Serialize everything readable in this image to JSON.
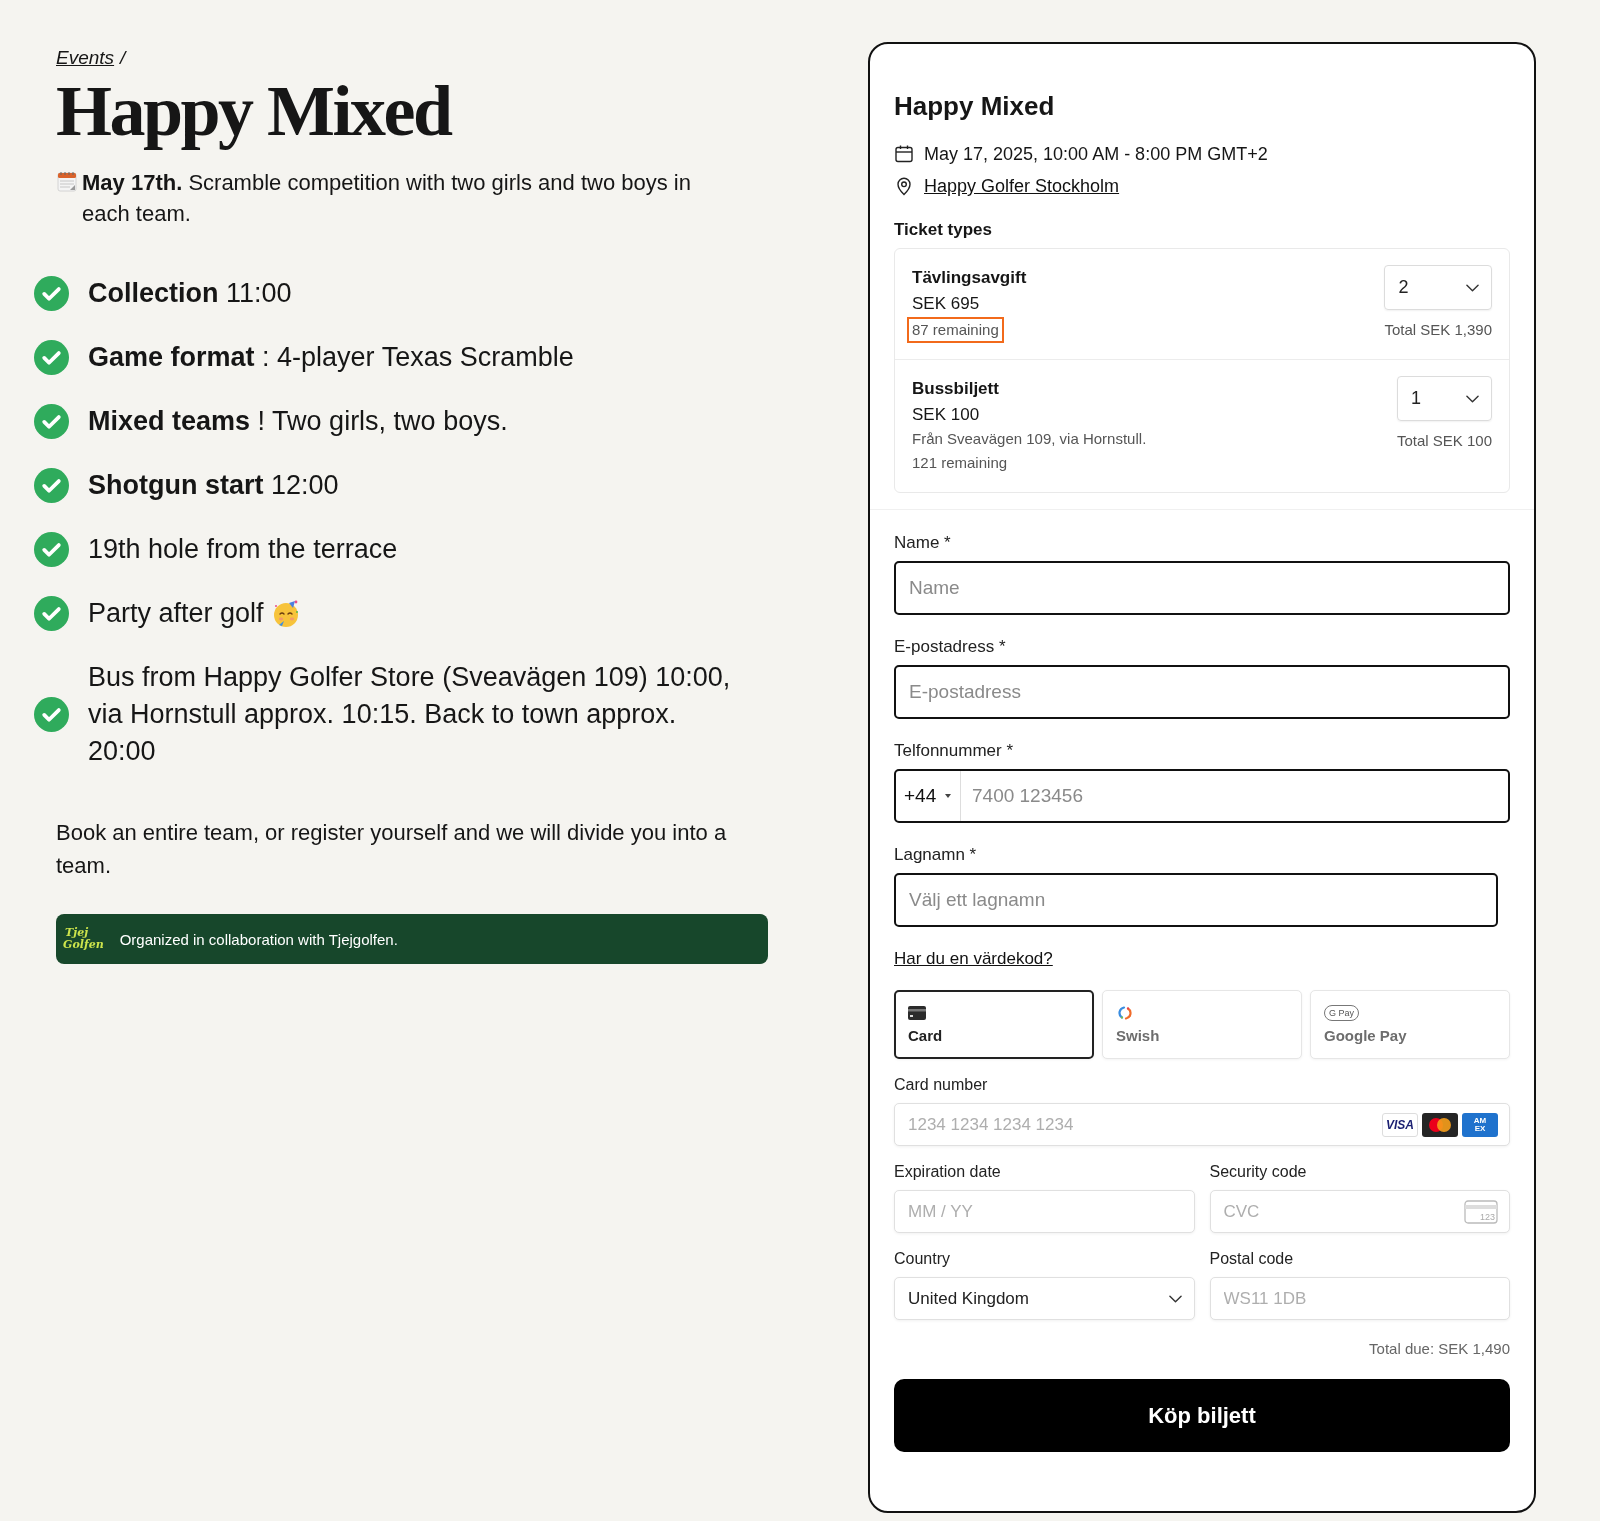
{
  "breadcrumb": {
    "link": "Events",
    "separator": "/"
  },
  "title": "Happy Mixed",
  "intro": "**May 17th.** Scramble competition with two girls and two boys in each team.",
  "features": [
    {
      "text": "**Collection** 11:00",
      "kind": "plain"
    },
    {
      "text": "**Game format** : 4-player Texas Scramble",
      "kind": "plain"
    },
    {
      "text": "**Mixed teams** ! Two girls, two boys.",
      "kind": "plain"
    },
    {
      "text": "**Shotgun start** 12:00",
      "kind": "plain"
    },
    {
      "text": "19th hole from the terrace",
      "kind": "plain"
    },
    {
      "text": "Party after golf",
      "kind": "emoji"
    },
    {
      "text": "Bus from Happy Golfer Store (Sveavägen 109) 10:00, via Hornstull approx. 10:15. Back to town approx. 20:00",
      "kind": "plain"
    }
  ],
  "note": "Book an entire team, or register yourself and we will divide you into a team.",
  "partner_banner": {
    "logo_lines": [
      "Tjej",
      "Golfen"
    ],
    "text": "Organized in collaboration with Tjejgolfen."
  },
  "checkout": {
    "title": "Happy Mixed",
    "date": "May 17, 2025, 10:00 AM - 8:00 PM GMT+2",
    "venue": "Happy Golfer Stockholm",
    "tickets_heading": "Ticket types",
    "tickets": [
      {
        "name": "Tävlingsavgift",
        "price": "SEK 695",
        "remaining": "87 remaining",
        "highlighted": true,
        "quantity": "2",
        "total": "Total SEK 1,390"
      },
      {
        "name": "Bussbiljett",
        "price": "SEK 100",
        "description": "Från Sveavägen 109, via Hornstull.",
        "remaining": "121 remaining",
        "highlighted": false,
        "quantity": "1",
        "total": "Total SEK 100"
      }
    ],
    "fields": [
      {
        "kind": "text",
        "label": "Name *",
        "placeholder": "Name"
      },
      {
        "kind": "text",
        "label": "E-postadress *",
        "placeholder": "E-postadress"
      },
      {
        "kind": "phone",
        "label": "Telfonnummer *",
        "prefix": "+44",
        "placeholder": "7400 123456"
      },
      {
        "kind": "combo",
        "label": "Lagnamn *",
        "placeholder": "Välj ett lagnamn"
      }
    ],
    "voucher_link": "Har du en värdekod?",
    "payment_methods": [
      {
        "kind": "card",
        "label": "Card",
        "selected": true
      },
      {
        "kind": "swish",
        "label": "Swish",
        "selected": false
      },
      {
        "kind": "gpay",
        "label": "Google Pay",
        "icon_text": "G Pay",
        "selected": false
      }
    ],
    "card_number": {
      "label": "Card number",
      "placeholder": "1234 1234 1234 1234",
      "brands": [
        {
          "kind": "visa",
          "lines": [
            "VISA"
          ]
        },
        {
          "kind": "mastercard"
        },
        {
          "kind": "amex",
          "lines": [
            "AM",
            "EX"
          ]
        }
      ]
    },
    "expiry": {
      "label": "Expiration date",
      "placeholder": "MM / YY"
    },
    "security_code": {
      "label": "Security code",
      "placeholder": "CVC",
      "icon_text": "123"
    },
    "country": {
      "label": "Country",
      "value": "United Kingdom"
    },
    "postal_code": {
      "label": "Postal code",
      "placeholder": "WS11 1DB"
    },
    "total_due": "Total due: SEK 1,490",
    "submit": "Köp biljett"
  }
}
